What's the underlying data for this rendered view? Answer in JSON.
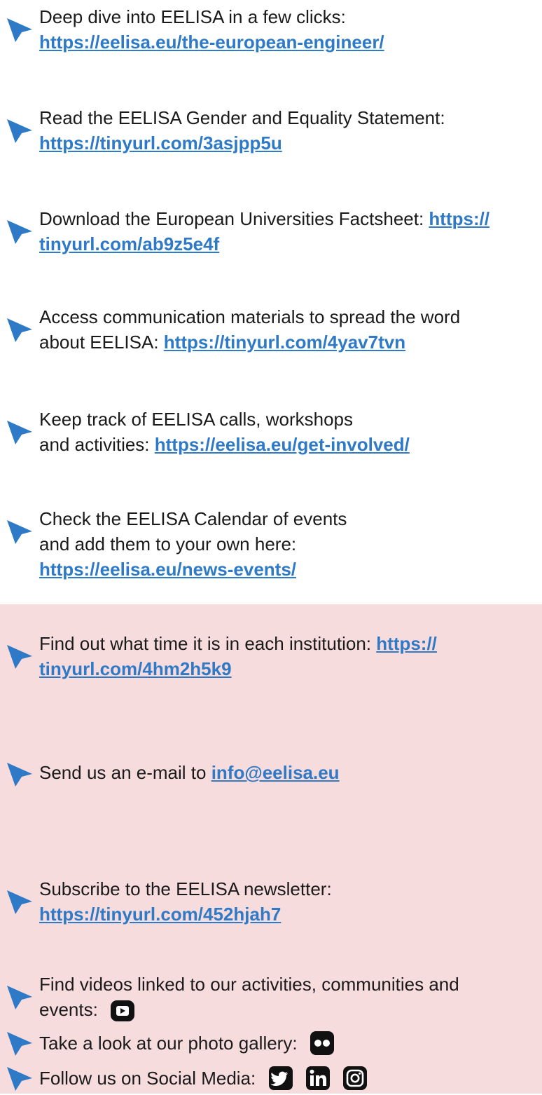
{
  "colors": {
    "link": "#2e7ac6",
    "cursor": "#2e7ac6",
    "pink_section": "#f7dcde"
  },
  "items": [
    {
      "text": "Deep dive into EELISA in a few clicks:",
      "link": "https://eelisa.eu/the-european-engineer/"
    },
    {
      "text": "Read the EELISA Gender and Equality Statement:",
      "link": "https://tinyurl.com/3asjpp5u"
    },
    {
      "text": "Download the European Universities Factsheet:",
      "link_part1": "https://",
      "link_part2": "tinyurl.com/ab9z5e4f"
    },
    {
      "text": "Access communication materials to spread the word",
      "text2": "about EELISA:",
      "link": "https://tinyurl.com/4yav7tvn"
    },
    {
      "text": "Keep track of EELISA calls, workshops",
      "text2": "and activities:",
      "link": "https://eelisa.eu/get-involved/"
    },
    {
      "text": "Check the EELISA Calendar of events",
      "text2": "and add them to your own here:",
      "link": "https://eelisa.eu/news-events/"
    },
    {
      "text": "Find out what time it is in each institution:",
      "link_part1": "https://",
      "link_part2": "tinyurl.com/4hm2h5k9"
    },
    {
      "text": "Send us an e-mail to",
      "link": "info@eelisa.eu"
    },
    {
      "text": "Subscribe to the EELISA newsletter:",
      "link": "https://tinyurl.com/452hjah7"
    },
    {
      "text": "Find videos linked to our activities, communities and",
      "text2": "events:",
      "icon": "youtube-icon"
    },
    {
      "text": "Take a look at our photo gallery:",
      "icon": "flickr-icon"
    },
    {
      "text": "Follow us on Social Media:",
      "icons": [
        "twitter-icon",
        "linkedin-icon",
        "instagram-icon"
      ]
    }
  ]
}
